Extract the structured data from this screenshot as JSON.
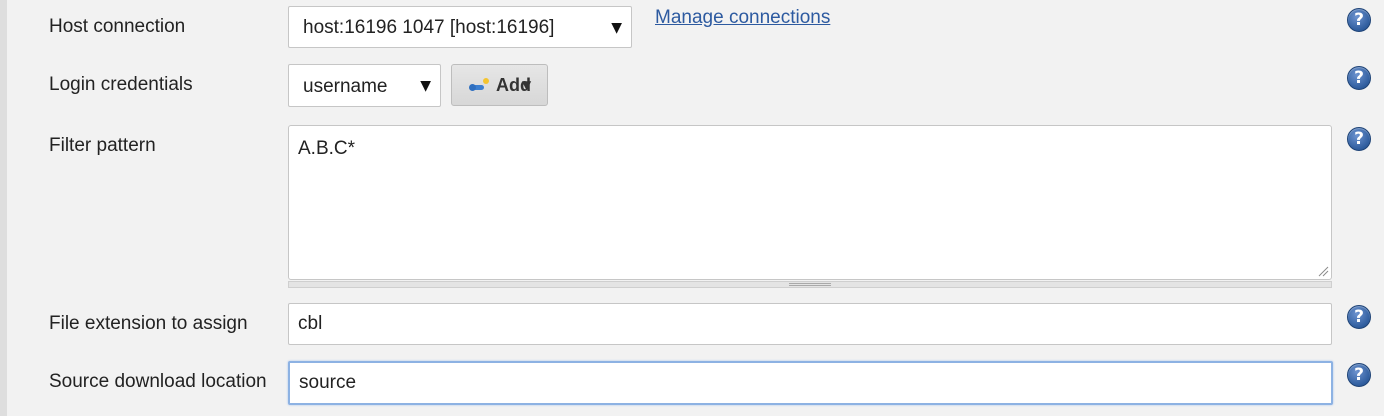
{
  "form": {
    "host_connection": {
      "label": "Host connection",
      "value": "host:16196 1047 [host:16196]",
      "manage_link": "Manage connections"
    },
    "login_credentials": {
      "label": "Login credentials",
      "value": "username",
      "add_label": "Add"
    },
    "filter_pattern": {
      "label": "Filter pattern",
      "value": "A.B.C*"
    },
    "file_extension": {
      "label": "File extension to assign",
      "value": "cbl"
    },
    "source_location": {
      "label": "Source download location",
      "value": "source"
    }
  },
  "help_glyph": "?",
  "dropdown_glyph": "▼",
  "icons": {
    "help": "help-icon",
    "dropdown": "chevron-down-icon",
    "key": "key-icon",
    "resize": "resize-grip-icon"
  },
  "colors": {
    "background": "#f2f2f2",
    "link": "#2d5aa0",
    "help_icon": "#2f5d9e",
    "focus_border": "#8db2e3"
  }
}
